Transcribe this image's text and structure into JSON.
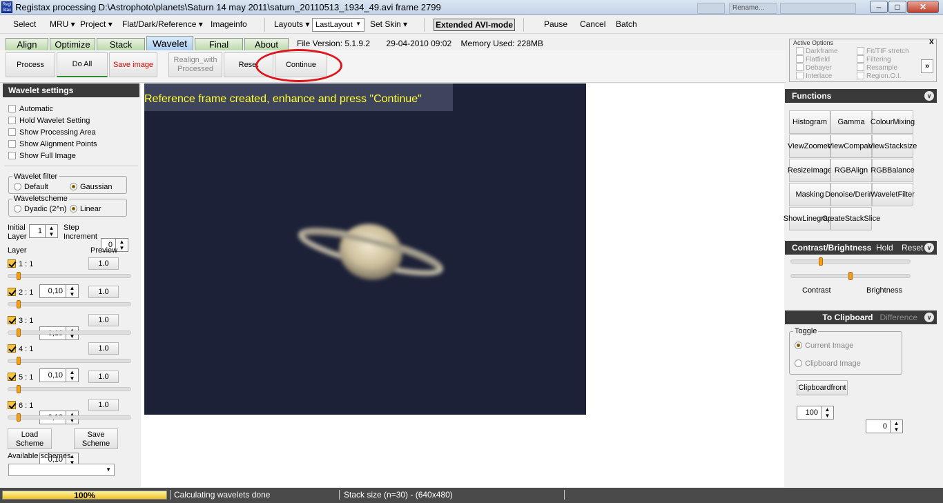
{
  "window": {
    "title": "Registax processing D:\\Astrophoto\\planets\\Saturn 14 may 2011\\saturn_20110513_1934_49.avi frame 2799",
    "icon_text": "Regi Stax",
    "taskbar_item": "Rename..."
  },
  "menu": {
    "select": "Select",
    "mru": "MRU",
    "project": "Project",
    "flat_dark": "Flat/Dark/Reference",
    "imageinfo": "Imageinfo",
    "layouts": "Layouts",
    "layout_value": "LastLayout",
    "set_skin": "Set Skin",
    "extended_avi": "Extended AVI-mode",
    "pause": "Pause",
    "cancel": "Cancel",
    "batch": "Batch"
  },
  "tabs": [
    "Align",
    "Optimize",
    "Stack",
    "Wavelet",
    "Final",
    "About"
  ],
  "active_tab": "Wavelet",
  "info": {
    "file_version": "File Version: 5.1.9.2",
    "date": "29-04-2010 09:02",
    "memory": "Memory Used: 228MB"
  },
  "toolbar": {
    "process": "Process",
    "do_all": "Do All",
    "save_image": "Save image",
    "realign_line1": "Realign_with",
    "realign_line2": "Processed",
    "reset": "Reset",
    "continue": "Continue"
  },
  "active_options": {
    "title": "Active Options",
    "close": "X",
    "more": "»",
    "left": [
      "Darkframe",
      "Flatfield",
      "Debayer",
      "Interlace"
    ],
    "right": [
      "Fit/TIF stretch",
      "Filtering",
      "Resample",
      "Region.O.I."
    ]
  },
  "wavelet_settings": {
    "header": "Wavelet settings",
    "checkboxes": [
      "Automatic",
      "Hold Wavelet Setting",
      "Show Processing Area",
      "Show Alignment Points",
      "Show Full Image"
    ],
    "filter_title": "Wavelet filter",
    "filter_options": [
      "Default",
      "Gaussian"
    ],
    "filter_selected": "Gaussian",
    "scheme_title": "Waveletscheme",
    "scheme_options": [
      "Dyadic (2^n)",
      "Linear"
    ],
    "scheme_selected": "Linear",
    "initial_label_1": "Initial",
    "initial_label_2": "Layer",
    "initial_value": "1",
    "step_label_1": "Step",
    "step_label_2": "Increment",
    "step_value": "0",
    "layer_header": "Layer",
    "preview_header": "Preview",
    "layers": [
      {
        "label": "1 : 1",
        "value": "0,10",
        "preview": "1.0",
        "slider": 0.05
      },
      {
        "label": "2 : 1",
        "value": "0,10",
        "preview": "1.0",
        "slider": 0.05
      },
      {
        "label": "3 : 1",
        "value": "0,10",
        "preview": "1.0",
        "slider": 0.05
      },
      {
        "label": "4 : 1",
        "value": "0,10",
        "preview": "1.0",
        "slider": 0.05
      },
      {
        "label": "5 : 1",
        "value": "0,10",
        "preview": "1.0",
        "slider": 0.05
      },
      {
        "label": "6 : 1",
        "value": "0,10",
        "preview": "1.0",
        "slider": 0.05
      }
    ],
    "load_1": "Load",
    "load_2": "Scheme",
    "save_1": "Save",
    "save_2": "Scheme",
    "available_schemes": "Available schemes"
  },
  "image": {
    "message": "Reference frame created, enhance and press \"Continue\""
  },
  "functions": {
    "header": "Functions",
    "buttons": [
      [
        "Histogram"
      ],
      [
        "Gamma"
      ],
      [
        "Colour",
        "Mixing"
      ],
      [
        "View",
        "Zoomed"
      ],
      [
        "View",
        "Compare"
      ],
      [
        "View",
        "Stacksize"
      ],
      [
        "Resize",
        "Image"
      ],
      [
        "RGB",
        "Align"
      ],
      [
        "RGB",
        "Balance"
      ],
      [
        "Masking"
      ],
      [
        "Denoise/",
        "Dering"
      ],
      [
        "Wavelet",
        "Filter"
      ],
      [
        "Show",
        "Linegraph"
      ],
      [
        "Create",
        "StackSlice"
      ]
    ]
  },
  "contrast_brightness": {
    "header": "Contrast/Brightness",
    "hold": "Hold",
    "reset": "Reset",
    "contrast_label": "Contrast",
    "contrast_value": "100",
    "brightness_label": "Brightness",
    "brightness_value": "0",
    "slider1": 0.25,
    "slider2": 0.5
  },
  "clipboard": {
    "header": "To Clipboard",
    "difference": "Difference",
    "toggle_title": "Toggle",
    "current_image": "Current Image",
    "clipboard_image": "Clipboard Image",
    "clipboardfront": "Clipboardfront"
  },
  "status": {
    "progress_text": "100%",
    "progress": 1.0,
    "message": "Calculating wavelets done",
    "stack": "Stack size (n=30) - (640x480)"
  }
}
